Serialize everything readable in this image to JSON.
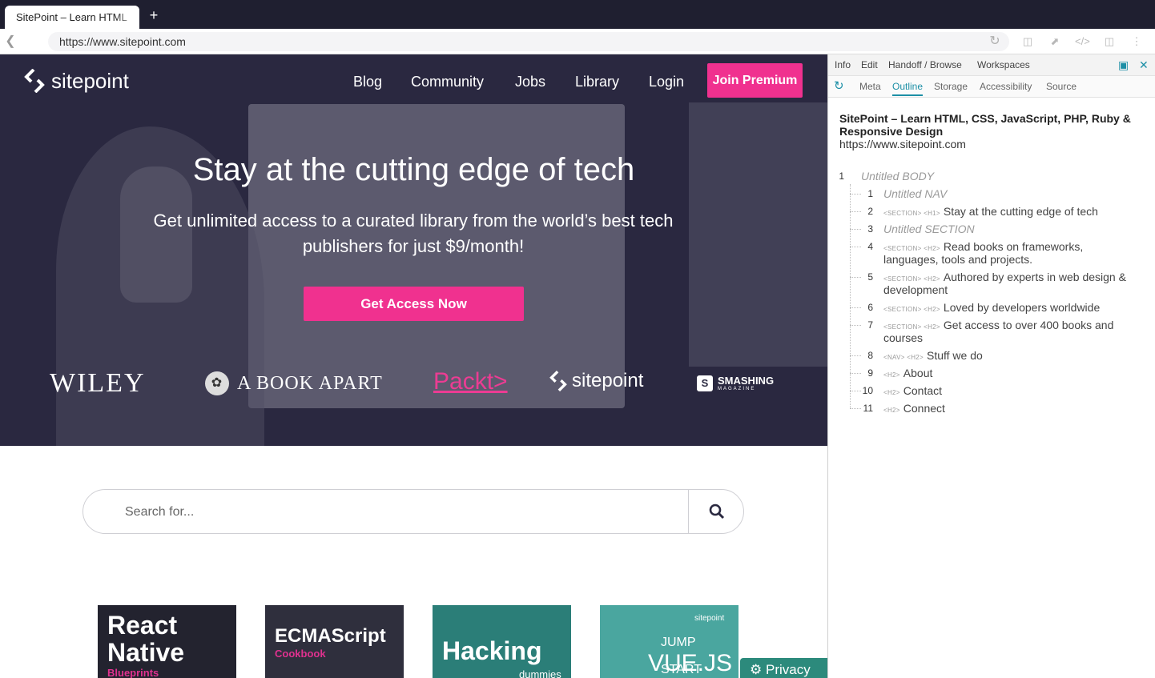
{
  "browser": {
    "tab_title": "SitePoint – Learn HTML",
    "new_tab": "+",
    "url": "https://www.sitepoint.com"
  },
  "site": {
    "logo_text": "sitepoint",
    "nav": [
      "Blog",
      "Community",
      "Jobs",
      "Library",
      "Login"
    ],
    "premium_button": "Join Premium",
    "hero_title": "Stay at the cutting edge of tech",
    "hero_subtitle": "Get unlimited access to a curated library from the world’s best tech publishers for just $9/month!",
    "cta_button": "Get Access Now",
    "publishers": {
      "wiley": "WILEY",
      "bookapart": "A BOOK APART",
      "packt": "Packt>",
      "sitepoint": "sitepoint",
      "smashing": "SMASHING",
      "smashing_sub": "MAGAZINE"
    },
    "search_placeholder": "Search for...",
    "books": [
      {
        "title_line1": "React",
        "title_line2": "Native",
        "subtitle": "Blueprints"
      },
      {
        "title_line1": "ECMAScript",
        "title_line2": "",
        "subtitle": "Cookbook"
      },
      {
        "title_line1": "Hacking",
        "title_line2": "",
        "subtitle": "dummies"
      },
      {
        "title_line1": "JUMP START",
        "title_line2": "VUE.JS",
        "subtitle": "sitepoint"
      }
    ],
    "privacy_button": "Privacy",
    "colors": {
      "accent": "#f0318f",
      "hero_bg": "#2a2940",
      "privacy": "#2c8a7c"
    }
  },
  "panel": {
    "tabs": [
      "Info",
      "Edit",
      "Handoff / Browse",
      "Workspaces"
    ],
    "subtabs": [
      "Meta",
      "Outline",
      "Storage",
      "Accessibility",
      "Source"
    ],
    "active_subtab": "Outline",
    "page_title": "SitePoint – Learn HTML, CSS, JavaScript, PHP, Ruby & Responsive Design",
    "page_url": "https://www.sitepoint.com",
    "root": {
      "num": "1",
      "label": "Untitled BODY"
    },
    "outline": [
      {
        "num": "1",
        "tags": "",
        "text": "Untitled NAV",
        "untitled": true
      },
      {
        "num": "2",
        "tags": "<SECTION> <H1>",
        "text": "Stay at the cutting edge of tech",
        "untitled": false
      },
      {
        "num": "3",
        "tags": "",
        "text": "Untitled SECTION",
        "untitled": true
      },
      {
        "num": "4",
        "tags": "<SECTION> <H2>",
        "text": "Read books on frameworks,",
        "text2": "languages, tools and projects.",
        "untitled": false
      },
      {
        "num": "5",
        "tags": "<SECTION> <H2>",
        "text": "Authored by experts in web design &",
        "text2": "development",
        "untitled": false
      },
      {
        "num": "6",
        "tags": "<SECTION> <H2>",
        "text": "Loved by developers worldwide",
        "untitled": false
      },
      {
        "num": "7",
        "tags": "<SECTION> <H2>",
        "text": "Get access to over 400 books and",
        "text2": "courses",
        "untitled": false
      },
      {
        "num": "8",
        "tags": "<NAV> <H2>",
        "text": "Stuff we do",
        "untitled": false
      },
      {
        "num": "9",
        "tags": "<H2>",
        "text": "About",
        "untitled": false
      },
      {
        "num": "10",
        "tags": "<H2>",
        "text": "Contact",
        "untitled": false
      },
      {
        "num": "11",
        "tags": "<H2>",
        "text": "Connect",
        "untitled": false
      }
    ],
    "accent": "#1c8fa6"
  }
}
